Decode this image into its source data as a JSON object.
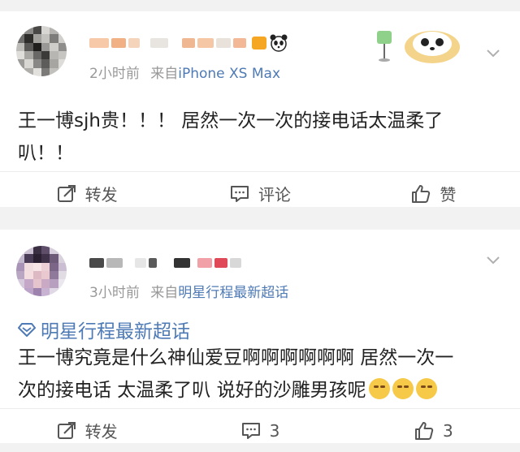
{
  "posts": [
    {
      "meta": {
        "time": "2小时前",
        "from_prefix": "来自",
        "source": "iPhone XS Max"
      },
      "text_lines": [
        "王一博sjh贵！！！ 居然一次一次的接电话太温柔了",
        "叭！！"
      ],
      "actions": {
        "repost": "转发",
        "comment": "评论",
        "like": "赞"
      }
    },
    {
      "meta": {
        "time": "3小时前",
        "from_prefix": "来自",
        "source": "明星行程最新超话"
      },
      "topic": "明星行程最新超话",
      "text_lines": [
        "王一博究竟是什么神仙爱豆啊啊啊啊啊啊  居然一次一",
        "次的接电话 太温柔了叭 说好的沙雕男孩呢"
      ],
      "actions": {
        "repost": "转发",
        "comment": "3",
        "like": "3"
      }
    }
  ],
  "colors": {
    "link": "#4e7ab5",
    "meta": "#999999",
    "action": "#555555",
    "bg": "#f2f2f2"
  },
  "icons": [
    "repost-icon",
    "comment-icon",
    "like-icon",
    "chevron-down-icon",
    "supertopic-icon",
    "laugh-cry-emoji"
  ]
}
